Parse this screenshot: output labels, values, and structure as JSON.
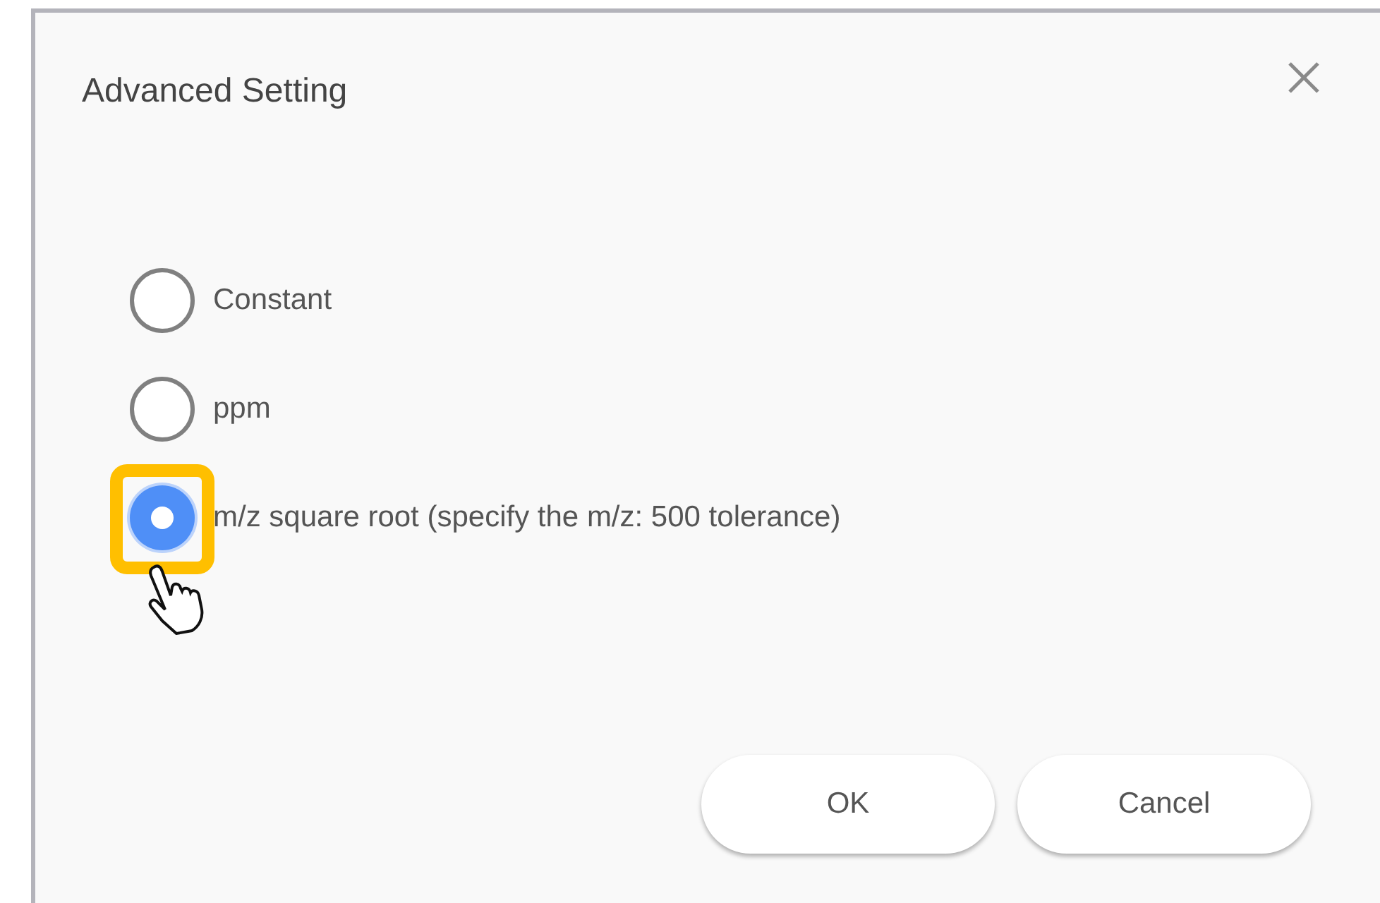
{
  "dialog": {
    "title": "Advanced Setting"
  },
  "options": [
    {
      "label": "Constant",
      "selected": false,
      "highlighted": false
    },
    {
      "label": "ppm",
      "selected": false,
      "highlighted": false
    },
    {
      "label": "m/z square root (specify the m/z: 500 tolerance)",
      "selected": true,
      "highlighted": true
    }
  ],
  "buttons": [
    "OK",
    "Cancel"
  ]
}
